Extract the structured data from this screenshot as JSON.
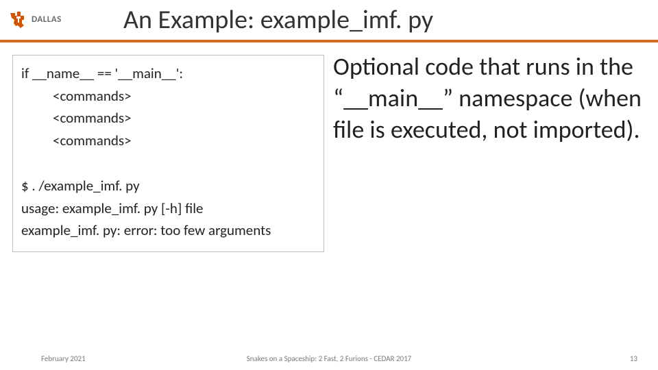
{
  "header": {
    "logo_text": "DALLAS",
    "title": "An Example: example_imf. py"
  },
  "code": {
    "line1": "if __name__ == '__main__':",
    "cmd1": "<commands>",
    "cmd2": "<commands>",
    "cmd3": "<commands>",
    "out1": "$ . /example_imf. py",
    "out2": "usage: example_imf. py [-h] file",
    "out3": "example_imf. py: error: too few arguments"
  },
  "right_text": "Optional code that runs in the “__main__” namespace (when file is executed, not imported).",
  "footer": {
    "left": "February 2021",
    "center": "Snakes on a Spaceship: 2 Fast, 2 Furions - CEDAR 2017",
    "right": "13"
  }
}
